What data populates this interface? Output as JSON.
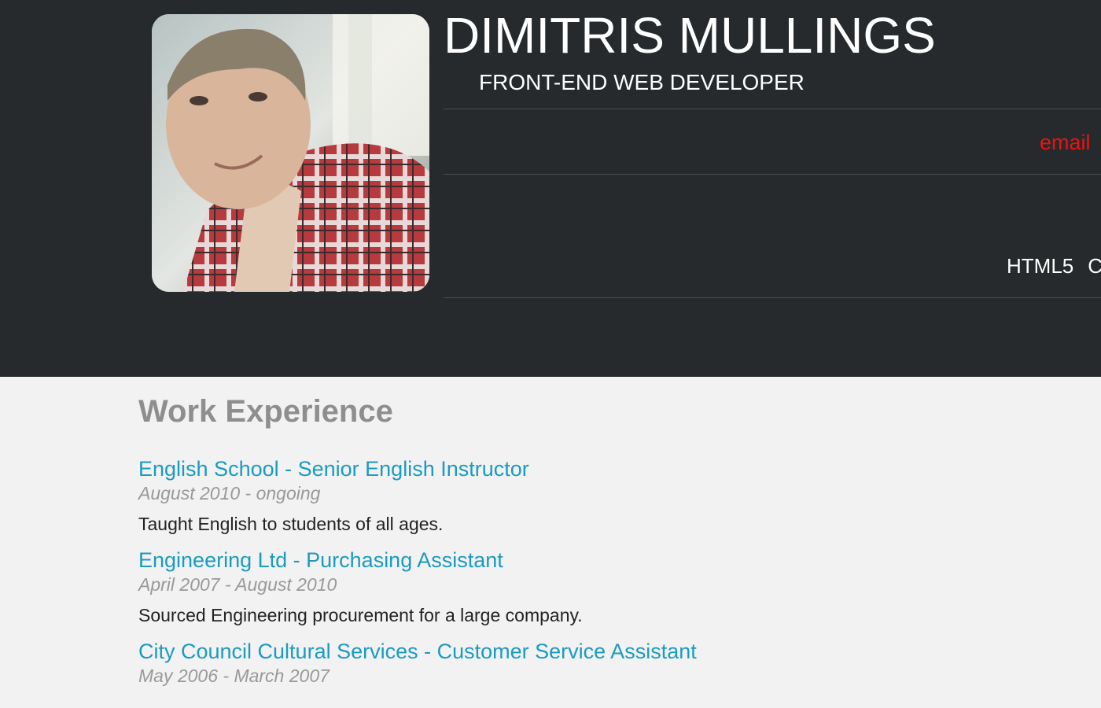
{
  "header": {
    "name": "DIMITRIS MULLINGS",
    "role": "FRONT-END WEB DEVELOPER",
    "email_link": "email",
    "skills": [
      "HTML5",
      "CS"
    ],
    "photo": "profile-photo"
  },
  "work": {
    "section_title": "Work Experience",
    "jobs": [
      {
        "title": "English School - Senior English Instructor",
        "dates": "August 2010 - ongoing",
        "description": "Taught English to students of all ages."
      },
      {
        "title": "Engineering Ltd - Purchasing Assistant",
        "dates": "April 2007 - August 2010",
        "description": "Sourced Engineering procurement for a large company."
      },
      {
        "title": "City Council Cultural Services - Customer Service Assistant",
        "dates": "May 2006 - March 2007",
        "description": ""
      }
    ]
  },
  "colors": {
    "header_bg": "#262a2c",
    "page_bg": "#f2f2f2",
    "link": "#1a9bc0",
    "email": "#ee1111",
    "section_title": "#8e8e8e"
  }
}
